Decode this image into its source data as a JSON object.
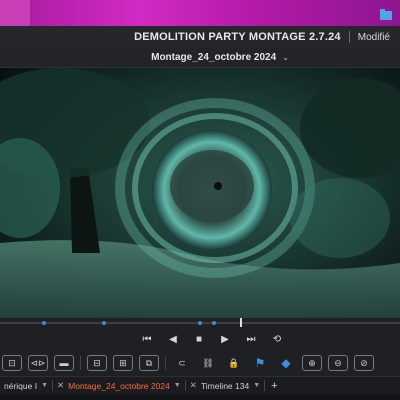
{
  "window": {
    "app_title": "DEMOLITION PARTY MONTAGE 2.7.24",
    "status": "Modifié",
    "project_name": "Montage_24_octobre 2024"
  },
  "transport": {
    "buttons": [
      "skip-back",
      "step-back",
      "stop",
      "play",
      "skip-forward",
      "loop"
    ]
  },
  "scrubber": {
    "playhead_fraction": 0.6
  },
  "timeline_tabs": [
    {
      "label": "nérique I",
      "active": false
    },
    {
      "label": "Montage_24_octobre 2024",
      "active": true
    },
    {
      "label": "Timeline 134",
      "active": false
    }
  ],
  "colors": {
    "accent_blue": "#3b8de6",
    "active_tab": "#ff6a3d",
    "wallpaper": "#d22ac4"
  }
}
